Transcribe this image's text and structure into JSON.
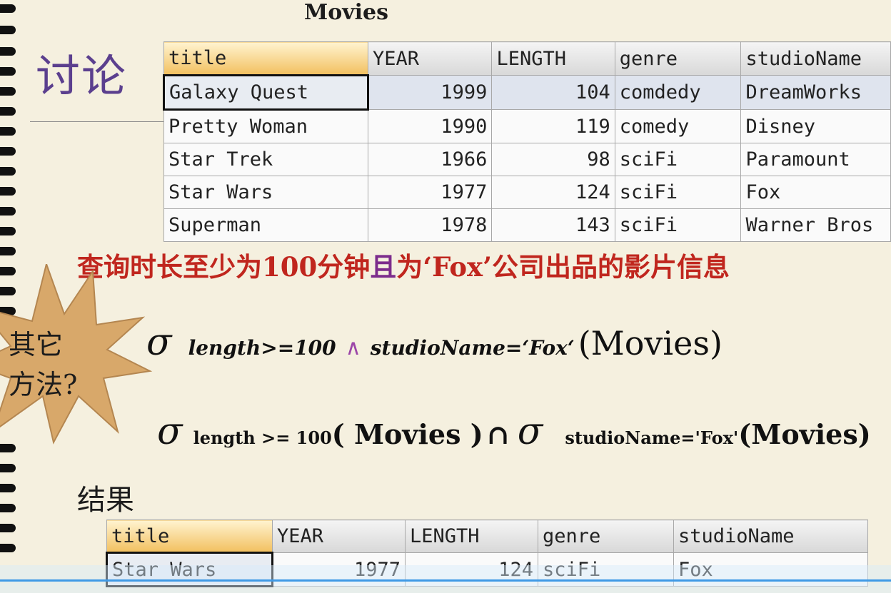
{
  "slide": {
    "title": "Movies",
    "discuss": "讨论",
    "question": {
      "part1": "查询时长至少为100分钟",
      "conj": "且",
      "part2": "为‘Fox’公司出品的影片信息"
    },
    "burst_text": [
      "其它",
      "方法?"
    ],
    "formula1": {
      "sigma": "σ",
      "condition_left": "length>=100",
      "and": "∧",
      "condition_right": "studioName=‘Fox‘",
      "relation": "(Movies)"
    },
    "formula2": {
      "sigma1": "σ",
      "condition1": "length >= 100",
      "relation1": "( Movies )",
      "intersect": "∩",
      "sigma2": "σ",
      "condition2": "studioName='Fox'",
      "relation2": "(Movies)"
    },
    "result_label": "结果"
  },
  "movies_table": {
    "columns": [
      "title",
      "YEAR",
      "LENGTH",
      "genre",
      "studioName"
    ],
    "rows": [
      [
        "Galaxy Quest",
        "1999",
        "104",
        "comdedy",
        "DreamWorks"
      ],
      [
        "Pretty Woman",
        "1990",
        "119",
        "comedy",
        "Disney"
      ],
      [
        "Star Trek",
        "1966",
        "98",
        "sciFi",
        "Paramount"
      ],
      [
        "Star Wars",
        "1977",
        "124",
        "sciFi",
        "Fox"
      ],
      [
        "Superman",
        "1978",
        "143",
        "sciFi",
        "Warner Bros"
      ]
    ]
  },
  "result_table": {
    "columns": [
      "title",
      "YEAR",
      "LENGTH",
      "genre",
      "studioName"
    ],
    "rows": [
      [
        "Star Wars",
        "1977",
        "124",
        "sciFi",
        "Fox"
      ]
    ]
  }
}
